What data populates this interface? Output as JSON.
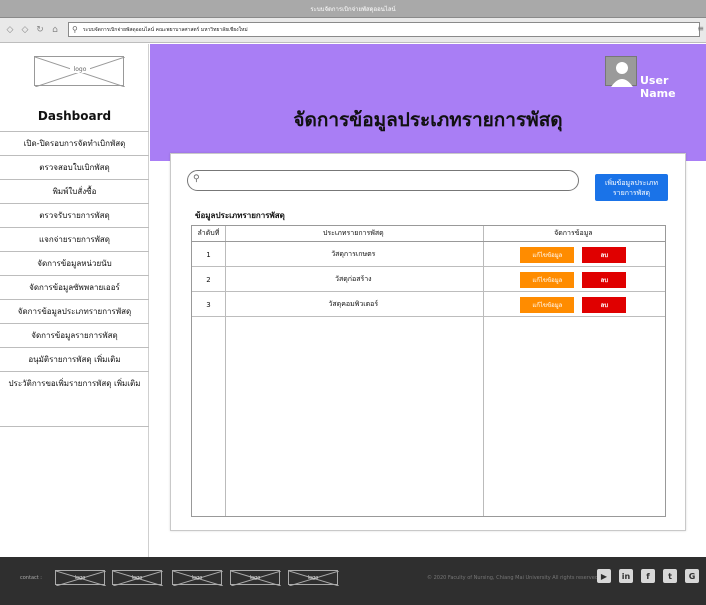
{
  "browser": {
    "title": "ระบบจัดการเบิกจ่ายพัสดุออนไลน์",
    "url": "ระบบจัดการเบิกจ่ายพัสดุออนไลน์ คณะพยาบาลศาสตร์ มหาวิทยาลัยเชียงใหม่"
  },
  "sidebar": {
    "logo": "logo",
    "heading": "Dashboard",
    "items": [
      "เปิด-ปิดรอบการจัดทำเบิกพัสดุ",
      "ตรวจสอบใบเบิกพัสดุ",
      "พิมพ์ใบสั่งซื้อ",
      "ตรวจรับรายการพัสดุ",
      "แจกจ่ายรายการพัสดุ",
      "จัดการข้อมูลหน่วยนับ",
      "จัดการข้อมูลซัพพลายเออร์",
      "จัดการข้อมูลประเภทรายการพัสดุ",
      "จัดการข้อมูลรายการพัสดุ",
      "อนุมัติรายการพัสดุ เพิ่มเติม",
      "ประวัติการขอเพิ่มรายการพัสดุ เพิ่มเติม"
    ]
  },
  "header": {
    "user_name": "User Name",
    "page_title": "จัดการข้อมูลประเภทรายการพัสดุ"
  },
  "main": {
    "search_placeholder": "",
    "add_button": "เพิ่มข้อมูลประเภทรายการพัสดุ",
    "section_title": "ข้อมูลประเภทรายการพัสดุ",
    "table": {
      "headers": [
        "ลำดับที่",
        "ประเภทรายการพัสดุ",
        "จัดการข้อมูล"
      ],
      "rows": [
        {
          "no": "1",
          "name": "วัสดุการเกษตร"
        },
        {
          "no": "2",
          "name": "วัสดุก่อสร้าง"
        },
        {
          "no": "3",
          "name": "วัสดุคอมพิวเตอร์"
        }
      ],
      "edit_label": "แก้ไขข้อมูล",
      "delete_label": "ลบ"
    }
  },
  "footer": {
    "contact": "contact :",
    "logos": [
      "logo",
      "logo",
      "logo",
      "logo",
      "logo"
    ],
    "copyright": "© 2020 Faculty of Nursing, Chiang Mai University All rights reserved",
    "social_icons": [
      "youtube-icon",
      "linkedin-icon",
      "facebook-icon",
      "twitter-icon",
      "google-plus-icon"
    ]
  },
  "colors": {
    "header_bg": "#a97ef5",
    "add_button": "#1a73e8",
    "edit_button": "#ff8c00",
    "delete_button": "#e00000",
    "footer_bg": "#2f2f2f"
  }
}
